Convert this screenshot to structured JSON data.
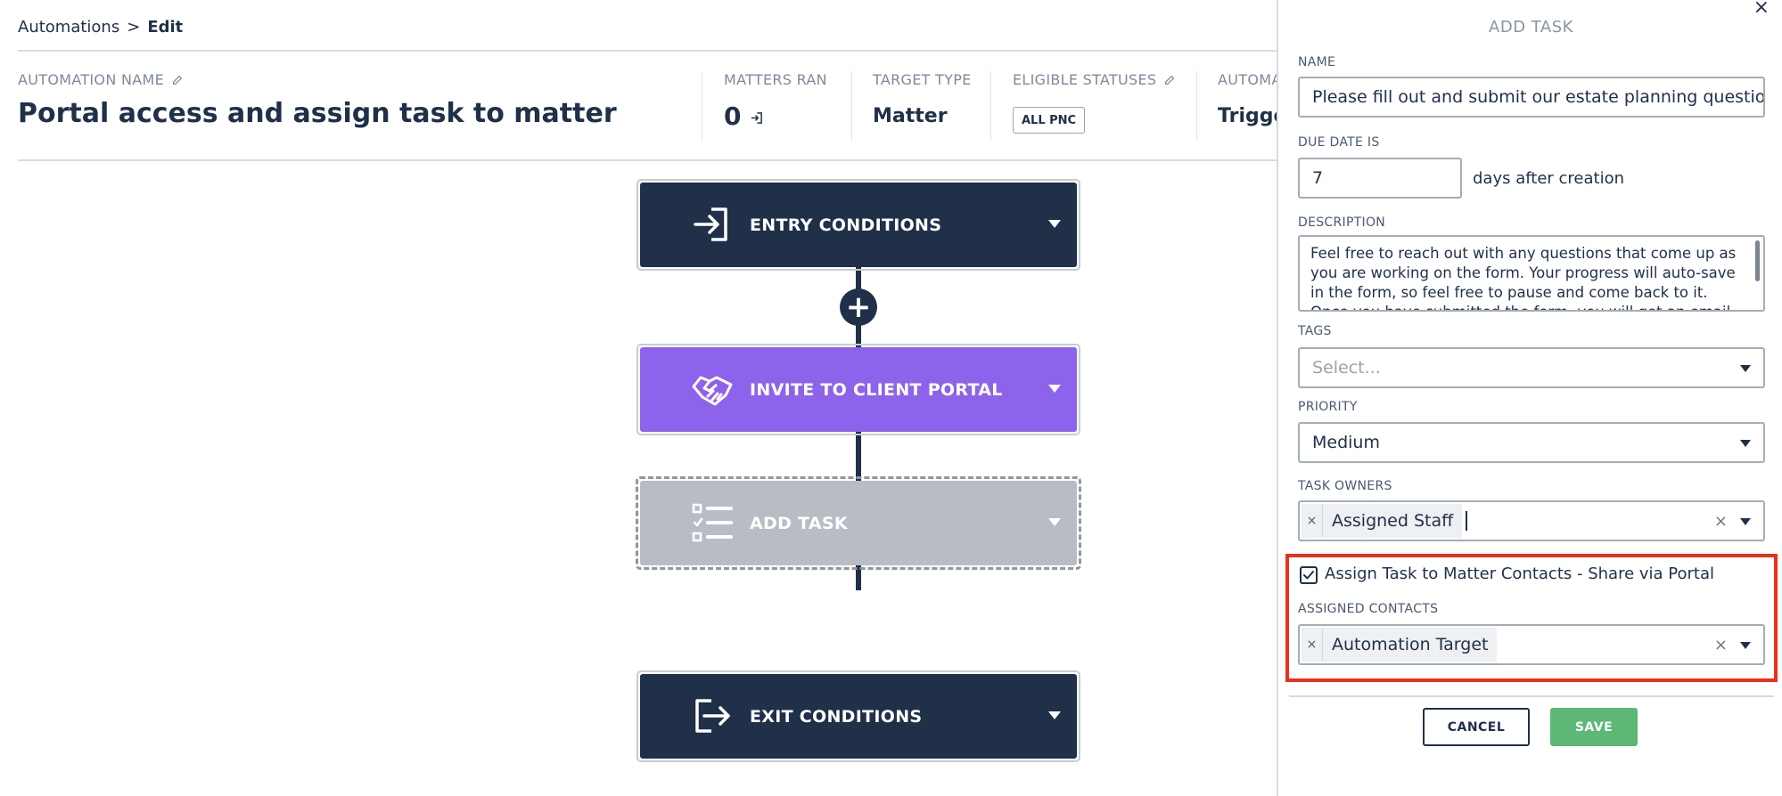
{
  "breadcrumb": {
    "parent": "Automations",
    "separator": ">",
    "current": "Edit"
  },
  "header": {
    "automation_name_label": "AUTOMATION NAME",
    "automation_name": "Portal access and assign task to matter",
    "matters_ran_label": "MATTERS RAN",
    "matters_ran_value": "0",
    "target_type_label": "TARGET TYPE",
    "target_type_value": "Matter",
    "eligible_statuses_label": "ELIGIBLE STATUSES",
    "eligible_statuses_badge": "ALL PNC",
    "truncated_label": "AUTOMA",
    "truncated_value": "Trigge"
  },
  "flow": {
    "steps": [
      {
        "label": "ENTRY CONDITIONS",
        "icon": "enter-icon",
        "color": "#1f3048"
      },
      {
        "label": "INVITE TO CLIENT PORTAL",
        "icon": "handshake-icon",
        "color": "#8c63ea"
      },
      {
        "label": "ADD TASK",
        "icon": "checklist-icon",
        "color": "#b8bcc4"
      },
      {
        "label": "EXIT CONDITIONS",
        "icon": "exit-icon",
        "color": "#1f3048"
      }
    ],
    "add_step_symbol": "+"
  },
  "panel": {
    "title": "ADD TASK",
    "close_symbol": "×",
    "name_label": "NAME",
    "name_value": "Please fill out and submit our estate planning questionnaire",
    "due_date_label": "DUE DATE IS",
    "due_date_value": "7",
    "due_date_suffix": "days after creation",
    "description_label": "DESCRIPTION",
    "description_value": "Feel free to reach out with any questions that come up as you are working on the form. Your progress will auto-save in the form, so feel free to pause and come back to it. Once you have submitted the form, you will get an email",
    "tags_label": "TAGS",
    "tags_placeholder": "Select...",
    "priority_label": "PRIORITY",
    "priority_value": "Medium",
    "task_owners_label": "TASK OWNERS",
    "task_owner_chip": "Assigned Staff",
    "assign_checkbox_label": "Assign Task to Matter Contacts - Share via Portal",
    "assign_checked": true,
    "assigned_contacts_label": "ASSIGNED CONTACTS",
    "assigned_contact_chip": "Automation Target",
    "chip_remove_symbol": "×",
    "clear_symbol": "×",
    "cancel_label": "CANCEL",
    "save_label": "SAVE",
    "highlight_color": "#e8311d",
    "save_color": "#5db777"
  }
}
